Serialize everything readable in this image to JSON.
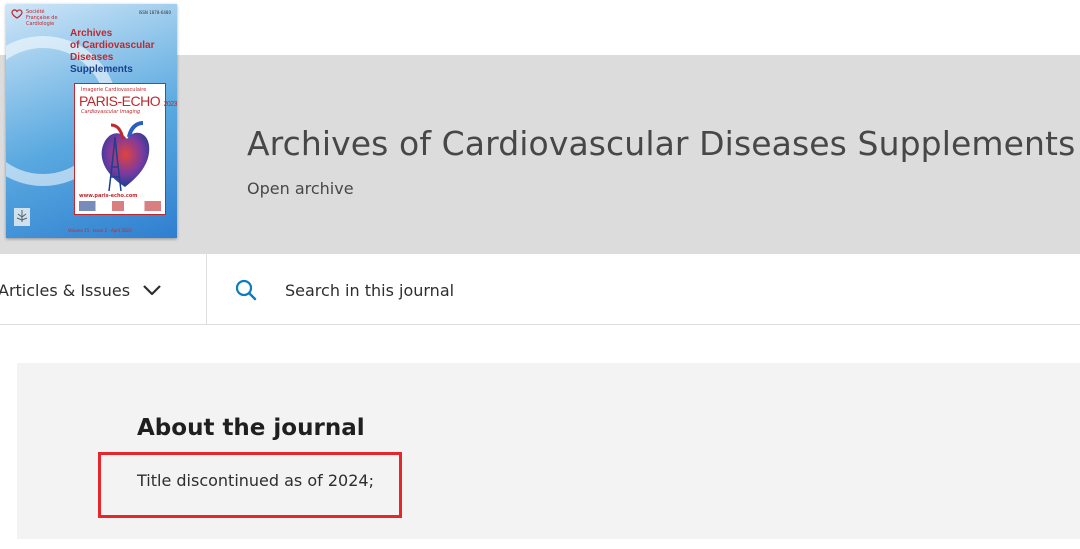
{
  "header": {
    "journal_title": "Archives of Cardiovascular Diseases Supplements",
    "access_label": "Open archive"
  },
  "cover": {
    "society_name": "Société Française de Cardiologie",
    "issn_text": "ISSN 1878-6480",
    "title_lines": [
      "Archives",
      "of Cardiovascular",
      "Diseases",
      "Supplements"
    ],
    "poster_line1": "Imagerie Cardiovasculaire",
    "poster_title": "PARIS-ECHO",
    "poster_year": "2023",
    "poster_subtitle": "Cardiovascular Imaging",
    "poster_url": "www.paris-echo.com",
    "footer_text": "Volume 15 · Issue 2 · April 2023",
    "publisher": "ELSEVIER"
  },
  "nav": {
    "articles_label": "Articles & Issues",
    "search_label": "Search in this journal"
  },
  "about": {
    "heading": "About the journal",
    "note": "Title discontinued as of 2024;"
  },
  "colors": {
    "band": "#dcdcdc",
    "highlight": "#e5262d",
    "search_icon": "#0c7dbb",
    "about_bg": "#f3f3f3"
  }
}
